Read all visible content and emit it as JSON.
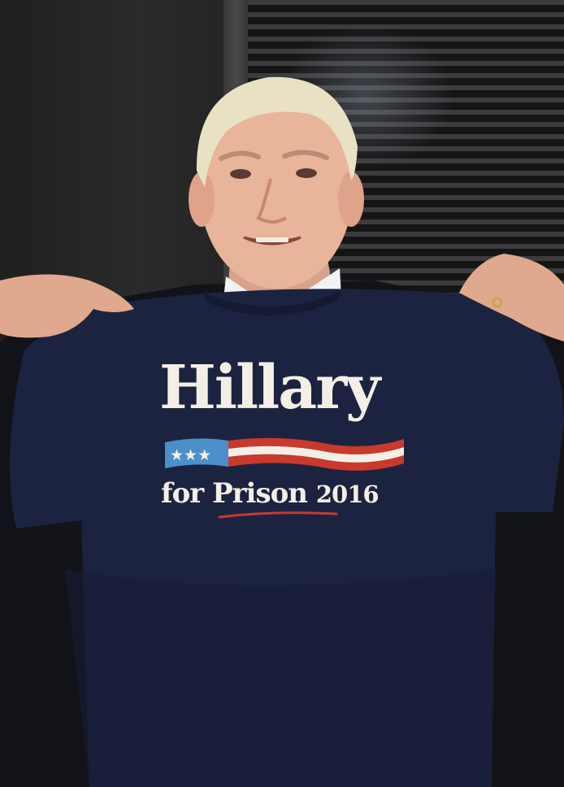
{
  "shirt": {
    "headline": "Hillary",
    "subline_prefix": "for",
    "subline_main": "Prison",
    "subline_year": "2016"
  },
  "colors": {
    "shirt_navy": "#1c2340",
    "print_cream": "#f4efe6",
    "flag_blue": "#4d8fc9",
    "flag_red": "#c9392c",
    "hair": "#e8e1c4",
    "skin": "#e8b49a"
  }
}
